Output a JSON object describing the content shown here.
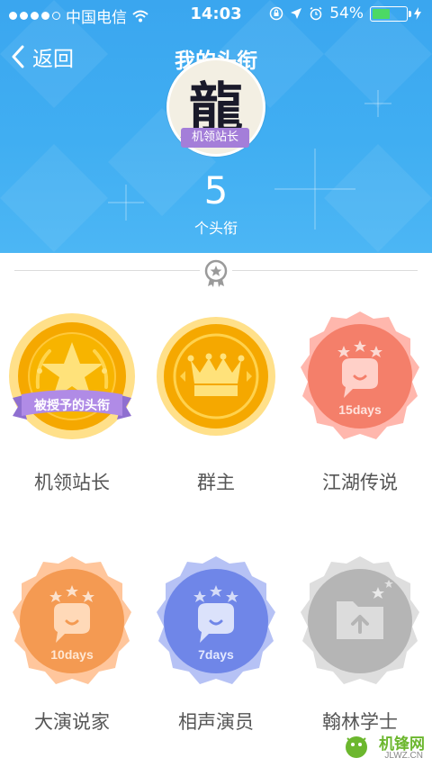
{
  "status_bar": {
    "carrier": "中国电信",
    "time": "14:03",
    "battery": "54%",
    "battery_level": 0.54
  },
  "nav": {
    "back_label": "返回",
    "title": "我的头衔"
  },
  "profile": {
    "avatar_char": "龍",
    "current_title": "机领站长",
    "count": "5",
    "count_label": "个头衔"
  },
  "badges": [
    {
      "name": "机领站长",
      "ribbon": "被授予的头衔",
      "icon": "star-laurel-icon",
      "color": "#f5a800",
      "state": "granted"
    },
    {
      "name": "群主",
      "icon": "crown-icon",
      "color": "#f5a800",
      "state": "earned"
    },
    {
      "name": "江湖传说",
      "days": "15days",
      "icon": "chat-bubble-icon",
      "color": "#f47f6a",
      "state": "earned"
    },
    {
      "name": "大演说家",
      "days": "10days",
      "icon": "chat-bubble-icon",
      "color": "#f49a52",
      "state": "earned"
    },
    {
      "name": "相声演员",
      "days": "7days",
      "icon": "chat-bubble-icon",
      "color": "#6f86e8",
      "state": "earned"
    },
    {
      "name": "翰林学士",
      "icon": "folder-upload-icon",
      "color": "#b5b5b5",
      "state": "locked"
    }
  ],
  "watermark": {
    "text": "机锋网",
    "sub": "JLWZ.CN"
  },
  "colors": {
    "header_blue": "#40aef2",
    "title_badge": "#a47ed9",
    "gold": "#f5a800",
    "coral": "#f47f6a",
    "orange": "#f49a52",
    "periwinkle": "#6f86e8",
    "gray": "#b5b5b5"
  }
}
